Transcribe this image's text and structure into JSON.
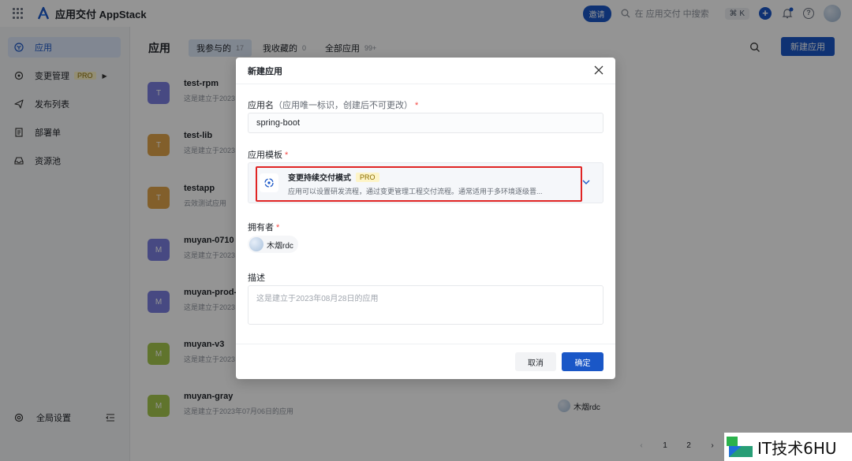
{
  "topbar": {
    "brand": "应用交付 AppStack",
    "invite": "邀请",
    "search_placeholder": "在 应用交付 中搜索",
    "shortcut": "⌘ K"
  },
  "sidebar": {
    "items": [
      {
        "label": "应用"
      },
      {
        "label": "变更管理",
        "badge": "PRO"
      },
      {
        "label": "发布列表"
      },
      {
        "label": "部署单"
      },
      {
        "label": "资源池"
      }
    ],
    "settings": "全局设置"
  },
  "main": {
    "title": "应用",
    "tabs": [
      {
        "label": "我参与的",
        "count": "17"
      },
      {
        "label": "我收藏的",
        "count": "0"
      },
      {
        "label": "全部应用",
        "count": "99+"
      }
    ],
    "new_button": "新建应用",
    "apps": [
      {
        "avatar": "T",
        "name": "test-rpm",
        "desc": "这是建立于2023"
      },
      {
        "avatar": "T",
        "name": "test-lib",
        "desc": "这是建立于2023"
      },
      {
        "avatar": "T",
        "name": "testapp",
        "desc": "云效测试应用"
      },
      {
        "avatar": "M",
        "name": "muyan-0710",
        "desc": "这是建立于2023"
      },
      {
        "avatar": "M",
        "name": "muyan-prod-",
        "desc": "这是建立于2023"
      },
      {
        "avatar": "M",
        "name": "muyan-v3",
        "desc": "这是建立于2023"
      },
      {
        "avatar": "M",
        "name": "muyan-gray",
        "desc": "这是建立于2023年07月06日的应用",
        "owner": "木烟rdc"
      }
    ],
    "pager": {
      "prev": "‹",
      "pages": [
        "1",
        "2"
      ],
      "next": "›"
    }
  },
  "modal": {
    "title": "新建应用",
    "name_label": "应用名",
    "name_hint": "（应用唯一标识，创建后不可更改）",
    "name_value": "spring-boot",
    "required_mark": "*",
    "template_label": "应用模板",
    "template": {
      "title": "变更持续交付模式",
      "badge": "PRO",
      "desc": "应用可以设置研发流程，通过变更管理工程交付流程。通常适用于多环境逐级晋..."
    },
    "owner_label": "拥有者",
    "owner_name": "木烟rdc",
    "desc_label": "描述",
    "desc_placeholder": "这是建立于2023年08月28日的应用",
    "cancel": "取消",
    "confirm": "确定"
  },
  "watermark": {
    "text": "IT技术6HU"
  },
  "colors": {
    "accent": "#1a57c7",
    "highlight": "#e02424",
    "pro_bg": "#fdf4c7"
  }
}
